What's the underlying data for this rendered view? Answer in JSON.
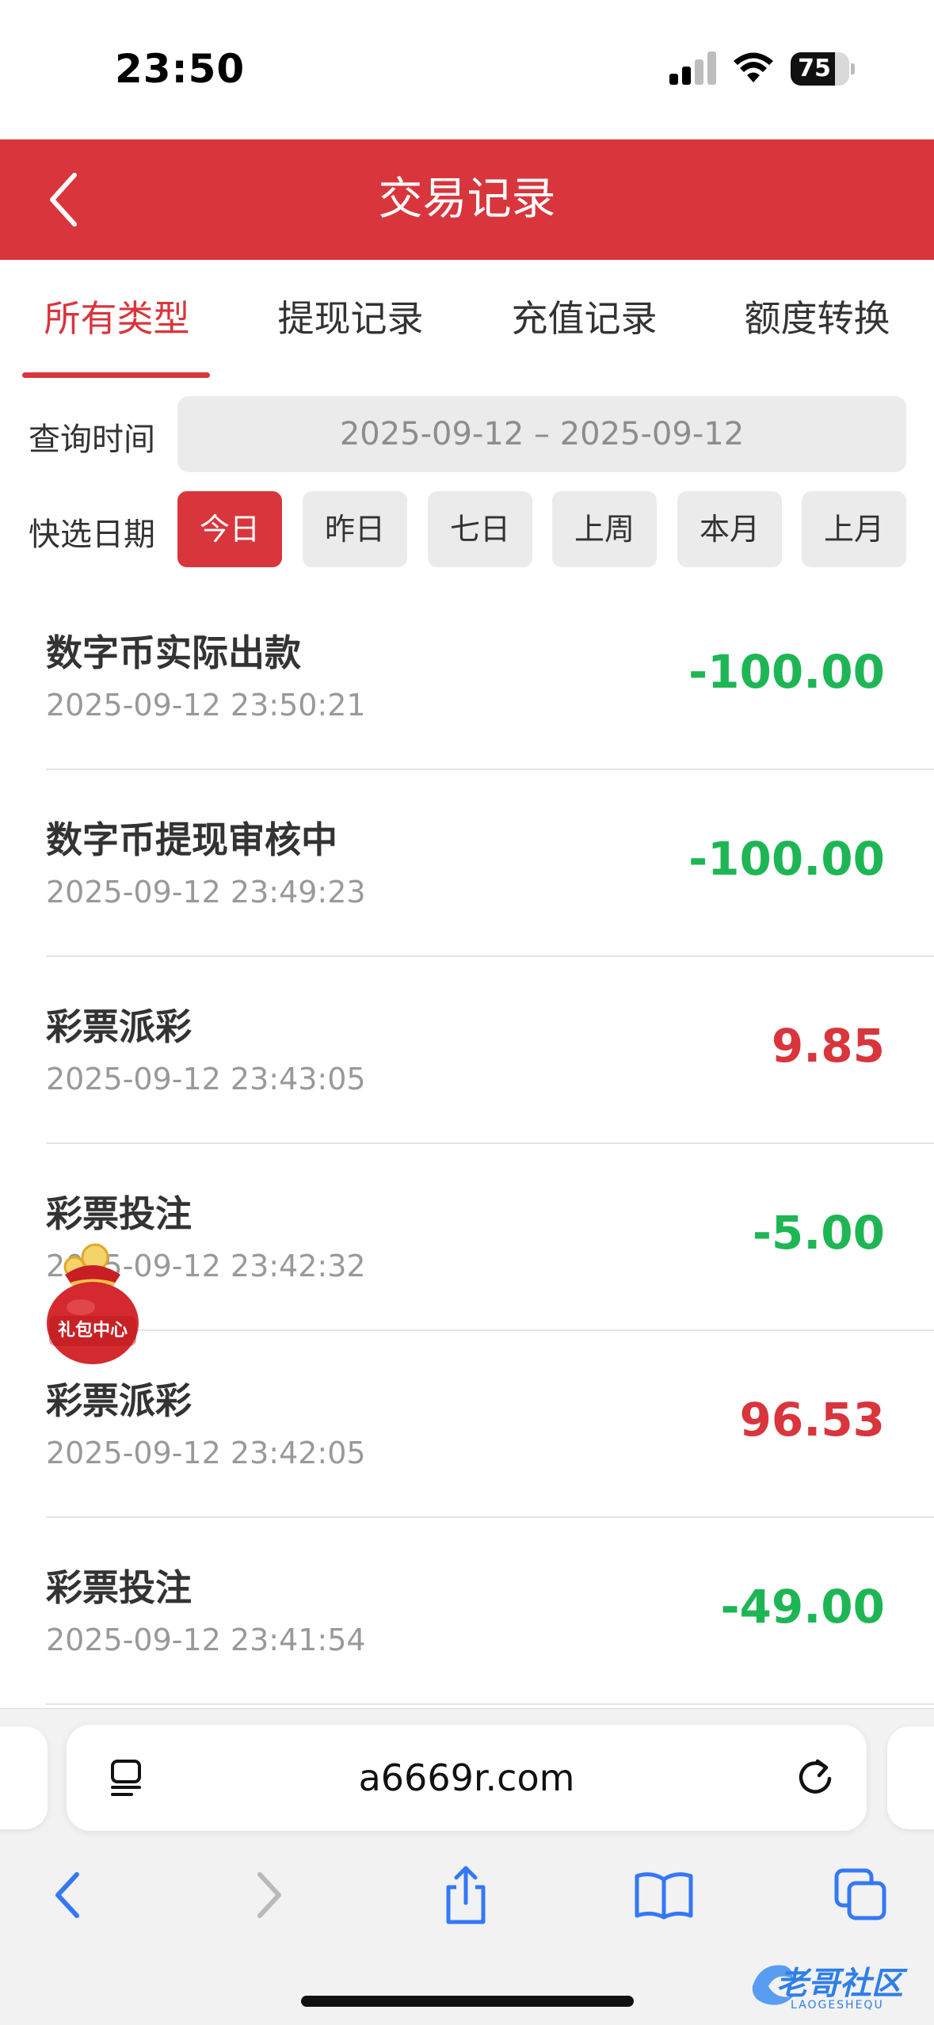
{
  "status_bar": {
    "time": "23:50",
    "battery": "75",
    "battery_level": 0.75
  },
  "header": {
    "title": "交易记录"
  },
  "tabs": [
    {
      "label": "所有类型",
      "active": true
    },
    {
      "label": "提现记录",
      "active": false
    },
    {
      "label": "充值记录",
      "active": false
    },
    {
      "label": "额度转换",
      "active": false
    }
  ],
  "filters": {
    "query_label": "查询时间",
    "date_range": "2025-09-12 – 2025-09-12",
    "quick_label": "快选日期",
    "quick_options": [
      {
        "label": "今日",
        "active": true
      },
      {
        "label": "昨日",
        "active": false
      },
      {
        "label": "七日",
        "active": false
      },
      {
        "label": "上周",
        "active": false
      },
      {
        "label": "本月",
        "active": false
      },
      {
        "label": "上月",
        "active": false
      }
    ]
  },
  "records": [
    {
      "title": "数字币实际出款",
      "time": "2025-09-12 23:50:21",
      "amount": "-100.00",
      "type": "negative"
    },
    {
      "title": "数字币提现审核中",
      "time": "2025-09-12 23:49:23",
      "amount": "-100.00",
      "type": "negative"
    },
    {
      "title": "彩票派彩",
      "time": "2025-09-12 23:43:05",
      "amount": "9.85",
      "type": "positive"
    },
    {
      "title": "彩票投注",
      "time": "2025-09-12 23:42:32",
      "amount": "-5.00",
      "type": "negative"
    },
    {
      "title": "彩票派彩",
      "time": "2025-09-12 23:42:05",
      "amount": "96.53",
      "type": "positive"
    },
    {
      "title": "彩票投注",
      "time": "2025-09-12 23:41:54",
      "amount": "-49.00",
      "type": "negative"
    }
  ],
  "gift": {
    "label": "礼包中心"
  },
  "browser": {
    "url": "a6669r.com"
  },
  "watermark": {
    "text": "老哥社区",
    "subtext": "LAOGESHEQU"
  },
  "colors": {
    "brand_red": "#d9353c",
    "amount_green": "#1eb655",
    "ios_blue": "#3478f6"
  }
}
